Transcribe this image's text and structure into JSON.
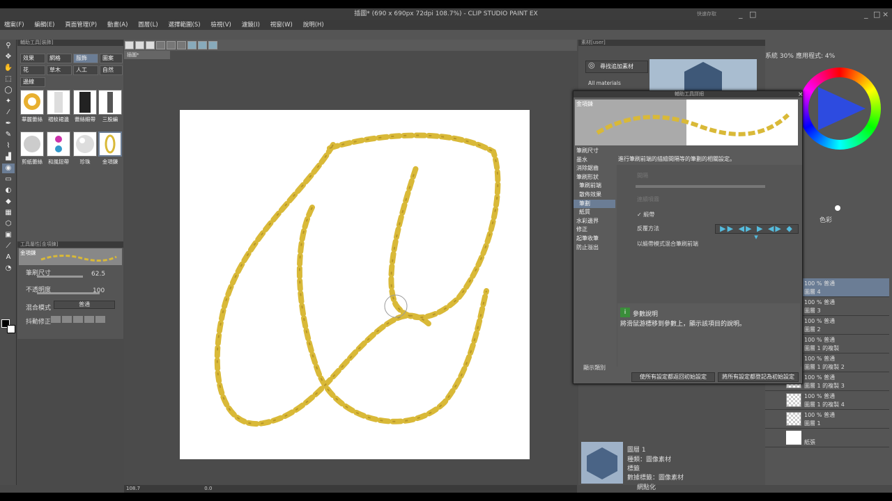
{
  "app": {
    "title": "插圖* (690 x 690px 72dpi 108.7%)  - CLIP STUDIO PAINT EX",
    "side_title": "快速存取",
    "window_controls": [
      "_",
      "□",
      "×"
    ]
  },
  "menu": [
    "檔案(F)",
    "編輯(E)",
    "頁面管理(P)",
    "動畫(A)",
    "圖層(L)",
    "選擇範圍(S)",
    "檢視(V)",
    "濾鏡(I)",
    "視窗(W)",
    "說明(H)"
  ],
  "document": {
    "tab_label": "插圖*",
    "zoom": "108.7"
  },
  "left_panel": {
    "header": "輔助工具[裝飾]",
    "sub_tabs": [
      "效果",
      "網格",
      "服飾",
      "圖案",
      "花",
      "草木",
      "人工",
      "自然",
      "邊線"
    ],
    "selected_tab": "服飾",
    "brushes": [
      "華麗蕾絲",
      "褶紋裙邊",
      "蕾絲緞帶",
      "三股編",
      "剪紙蕾絲",
      "和風鈕帶",
      "珍珠",
      "金項鍊"
    ]
  },
  "tool_property": {
    "header": "工具屬性[金項鍊]",
    "preset_name": "金項鍊",
    "brush_size_label": "筆刷尺寸",
    "brush_size_value": "62.5",
    "opacity_label": "不透明度",
    "opacity_value": "100",
    "blend_label": "混合模式",
    "blend_value": "普通",
    "stabilization_label": "抖動修正"
  },
  "material_panel": {
    "tab": "素材[user]",
    "search_button": "尋找追加素材",
    "tree_item": "All materials"
  },
  "color_panel": {
    "tab1": "系統 30%",
    "tab2": "應用程式: 4%",
    "color_set": "色彩"
  },
  "sub_tool_dialog": {
    "title": "輔助工具詳細",
    "preset_name": "金項鍊",
    "categories": [
      "筆刷尺寸",
      "墨水",
      "消除鋸齒",
      "筆刷形狀",
      "筆刷前端",
      "散佈效果",
      "筆劃",
      "紙質",
      "水彩邊界",
      "修正",
      "起筆收筆",
      "防止溢出"
    ],
    "selected_category": "筆劃",
    "description_line": "進行筆刷前端的描繪間隔等的筆劃的相關設定。",
    "params": [
      "間隔",
      "連續噴霧",
      "緞帶",
      "反覆方法",
      "以緞帶模式混合筆刷前端"
    ],
    "ribbon_checked": true,
    "info_title": "參數說明",
    "info_text": "將滑鼠游標移到參數上，顯示該項目的說明。",
    "show_category_label": "顯示類別",
    "reset_button": "使所有設定都返回初始設定",
    "save_button": "將所有設定都登記為初始設定"
  },
  "layers": [
    {
      "opacity": "100 % 普通",
      "name": "圖層 4"
    },
    {
      "opacity": "100 % 普通",
      "name": "圖層 3"
    },
    {
      "opacity": "100 % 普通",
      "name": "圖層 2"
    },
    {
      "opacity": "100 % 普通",
      "name": "圖層 1 的複製"
    },
    {
      "opacity": "100 % 普通",
      "name": "圖層 1 的複製 2"
    },
    {
      "opacity": "100 % 普通",
      "name": "圖層 1 的複製 3"
    },
    {
      "opacity": "100 % 普通",
      "name": "圖層 1 的複製 4"
    },
    {
      "opacity": "100 % 普通",
      "name": "圖層 1"
    }
  ],
  "paper_layer": "紙張",
  "layer_property": {
    "name": "圖層 1",
    "type": "種類：圖像素材",
    "tag": "標籤",
    "data_tag": "數據標籤：圖像素材",
    "checkbox": "網點化"
  },
  "status": {
    "zoom": "108.7",
    "angle": "0.0"
  },
  "colors": {
    "gold": "#d9b938",
    "accent": "#6b7d95",
    "canvas_bg": "#ffffff"
  }
}
